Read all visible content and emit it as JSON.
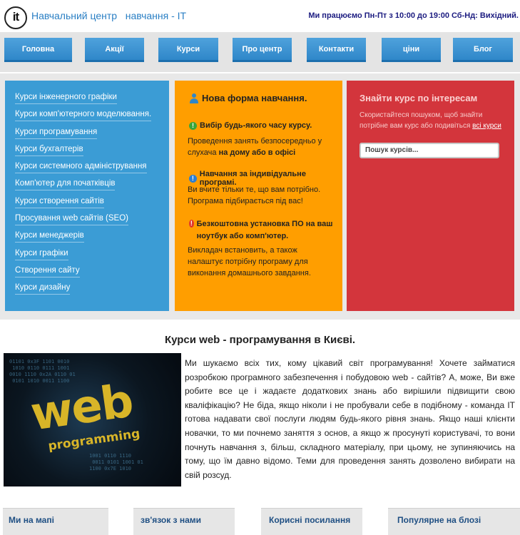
{
  "header": {
    "logo": "it",
    "site_title": "Навчальний центр   навчання - IT",
    "work_hours": "Ми працюємо Пн-Пт з 10:00 до 19:00 Сб-Нд: Вихідний."
  },
  "nav": [
    {
      "label": "Головна"
    },
    {
      "label": "Акції"
    },
    {
      "label": "Курси"
    },
    {
      "label": "Про центр"
    },
    {
      "label": "Контакти"
    },
    {
      "label": "ціни"
    },
    {
      "label": "Блог"
    }
  ],
  "courses": [
    "Курси інженерного графіки",
    "Курси комп'ютерного моделювання.",
    "Курси програмування",
    "Курси бухгалтерів",
    "Курси системного адміністрування",
    "Комп'ютер для початківців",
    "Курси створення сайтів",
    "Просування web сайтів (SEO)",
    "Курси менеджерів",
    "Курси графіки",
    "Створення сайту",
    "Курси дизайну"
  ],
  "new_form": {
    "title": "Нова форма навчання.",
    "sections": [
      {
        "icon": "info-green-icon",
        "heading": "Вибір будь-якого часу курсу.",
        "text_plain": "  Проведення занять безпосередньо у слухача ",
        "text_bold": "на дому або в офісі"
      },
      {
        "icon": "info-blue-icon",
        "heading": "Навчання за індивідуальне програмі.",
        "text_plain": "  Ви вчите тільки те, що вам потрібно. Програма підбирається під вас!",
        "text_bold": ""
      },
      {
        "icon": "info-red-icon",
        "heading": "Безкоштовна установка ПО на ваш ноутбук або комп'ютер.",
        "text_plain": "  Викладач встановить, а також налаштує потрібну програму для виконання домашнього завдання.",
        "text_bold": ""
      }
    ]
  },
  "search": {
    "title": "Знайти курс по інтересам",
    "desc": "Скористайтеся пошуком, щоб знайти потрібне вам курс або подивіться ",
    "link": "всі курси",
    "placeholder": "Пошук курсів..."
  },
  "article": {
    "title": "Курси web - програмування в Києві.",
    "image_word": "web",
    "image_sub": "programming",
    "text": "Ми шукаємо всіх тих, кому цікавий світ програмування! Хочете займатися розробкою програмного забезпечення і побудовою web - сайтів? А, може, Ви вже робите все це і жадаєте додаткових знань або вирішили підвищити свою кваліфікацію? Не біда, якщо ніколи і не пробували себе в подібному - команда IT готова надавати свої послуги людям будь-якого рівня знань. Якщо наші клієнти новачки, то ми почнемо заняття з основ, а якщо ж просунуті користувачі, то вони почнуть навчання з, більш, складного матеріалу, при цьому, не зупиняючись на тому, що їм давно відомо. Теми для проведення занять дозволено вибирати на свій розсуд."
  },
  "footer": [
    {
      "title": "Ми на мапі"
    },
    {
      "title": "зв'язок з нами"
    },
    {
      "title": "Корисні посилання"
    },
    {
      "title": "Популярне на блозі"
    }
  ],
  "colors": {
    "nav_blue": "#3b96d4",
    "card_blue": "#3b9cd5",
    "card_orange": "#ff9e00",
    "card_red": "#d3353c",
    "footer_title": "#1f4f83"
  }
}
